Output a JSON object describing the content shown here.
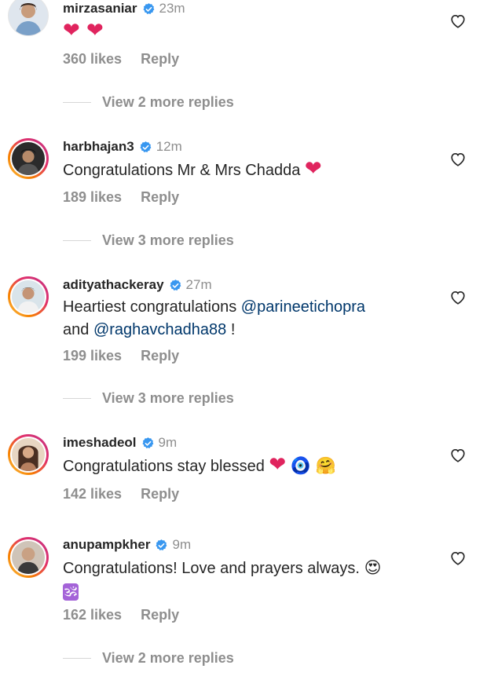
{
  "comments": [
    {
      "username": "mirzasaniar",
      "time": "23m",
      "text_parts": [],
      "emojis": "❤ ❤",
      "likes": "360 likes",
      "reply": "Reply",
      "view_replies": "View 2 more replies"
    },
    {
      "username": "harbhajan3",
      "time": "12m",
      "text": "Congratulations Mr & Mrs Chadda",
      "emojis": "❤",
      "likes": "189 likes",
      "reply": "Reply",
      "view_replies": "View 3 more replies"
    },
    {
      "username": "adityathackeray",
      "time": "27m",
      "text_1": "Heartiest congratulations ",
      "mention_1": "@parineetichopra",
      "text_2": "and ",
      "mention_2": "@raghavchadha88",
      "text_3": " !",
      "likes": "199 likes",
      "reply": "Reply",
      "view_replies": "View 3 more replies"
    },
    {
      "username": "imeshadeol",
      "time": "9m",
      "text": "Congratulations stay blessed",
      "emoji_heart": "❤",
      "emoji_evil_eye": "🧿",
      "emoji_hug": "🤗",
      "likes": "142 likes",
      "reply": "Reply"
    },
    {
      "username": "anupampkher",
      "time": "9m",
      "text": "Congratulations! Love and prayers always.",
      "emoji_face": "😍",
      "emoji_om": "🕉",
      "likes": "162 likes",
      "reply": "Reply",
      "view_replies": "View 2 more replies"
    }
  ],
  "colors": {
    "verified": "#3897f0",
    "mention": "#00376b",
    "heart": "#e0245e",
    "muted": "#8e8e8e"
  },
  "icons": {
    "verified": "verified-badge-icon",
    "like": "heart-outline-icon"
  }
}
